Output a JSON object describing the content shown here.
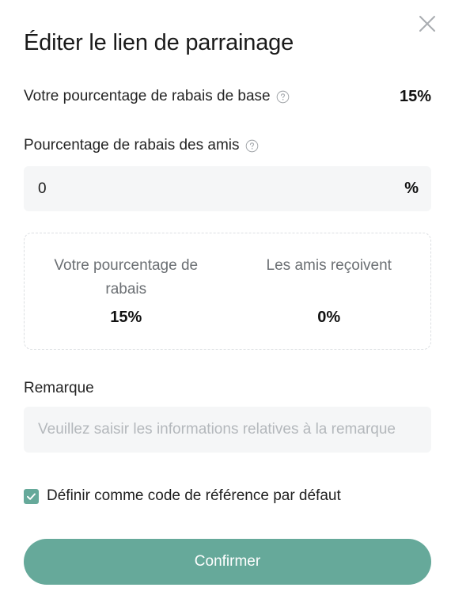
{
  "dialog": {
    "title": "Éditer le lien de parrainage"
  },
  "base_discount": {
    "label": "Votre pourcentage de rabais de base",
    "value": "15%",
    "help_icon": "question-circle-icon"
  },
  "friend_discount": {
    "label": "Pourcentage de rabais des amis",
    "help_icon": "question-circle-icon",
    "value": "0",
    "suffix": "%"
  },
  "summary": {
    "your_label": "Votre pourcentage de rabais",
    "your_value": "15%",
    "friends_label": "Les amis reçoivent",
    "friends_value": "0%"
  },
  "remark": {
    "label": "Remarque",
    "value": "",
    "placeholder": "Veuillez saisir les informations relatives à la remarque"
  },
  "default_checkbox": {
    "label": "Définir comme code de référence par défaut",
    "checked": true
  },
  "confirm_button": {
    "label": "Confirmer"
  },
  "colors": {
    "accent": "#66a99a",
    "input_bg": "#f5f6f7"
  },
  "icons": {
    "close": "close-icon",
    "check": "checkmark-icon"
  }
}
